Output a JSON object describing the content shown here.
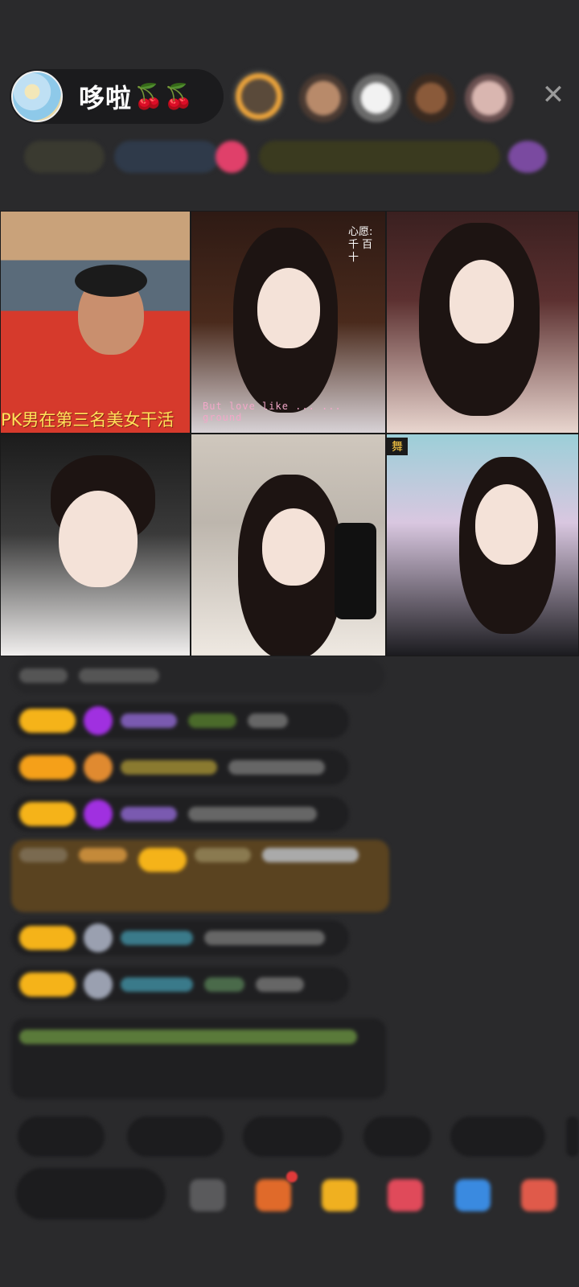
{
  "header": {
    "host_name": "哆啦",
    "host_emoji": "🍒🍒",
    "close_label": "✕"
  },
  "video_tiles": [
    {
      "caption": "PK男在第三名美女干活",
      "lyric": "",
      "wish": "",
      "tag": ""
    },
    {
      "caption": "",
      "lyric": "But love like ...   ...   ground",
      "wish": "心愿: 千 百 十",
      "tag": ""
    },
    {
      "caption": "",
      "lyric": "",
      "wish": "",
      "tag": ""
    },
    {
      "caption": "",
      "lyric": "",
      "wish": "",
      "tag": ""
    },
    {
      "caption": "",
      "lyric": "",
      "wish": "",
      "tag": ""
    },
    {
      "caption": "",
      "lyric": "",
      "wish": "",
      "tag": "舞"
    }
  ],
  "colors": {
    "background": "#2a2a2c",
    "badge": "#f5b319",
    "chat_bubble": "#1f1f21",
    "highlight_message": "#5a4320"
  },
  "icons": [
    "close-icon",
    "gift-icon",
    "game-icon",
    "share-icon",
    "more-icon"
  ]
}
